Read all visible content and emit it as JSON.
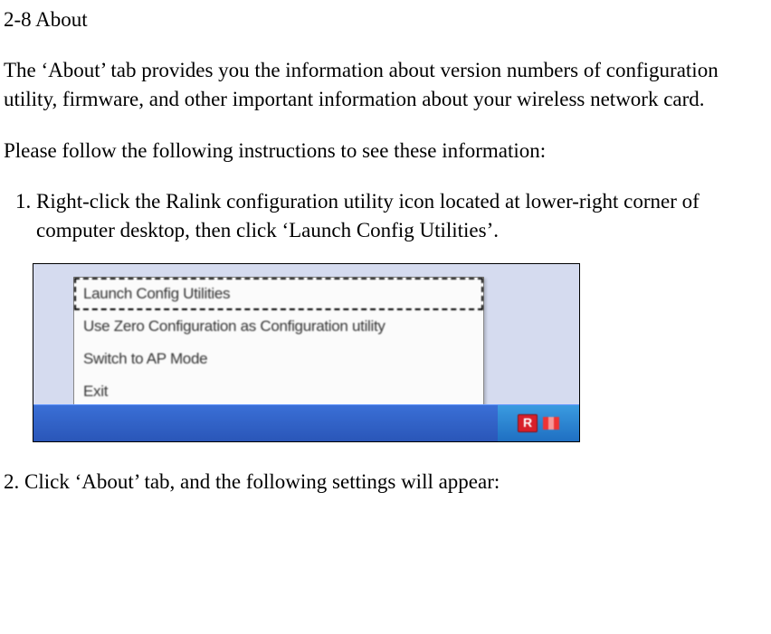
{
  "section": {
    "title": "2-8 About"
  },
  "para1": "The ‘About’ tab provides you the information about version numbers of configuration utility, firmware, and other important information about your wireless network card.",
  "para2": "Please follow the following instructions to see these information:",
  "step1_prefix": "1.",
  "step1_text": "Right-click the Ralink configuration utility icon located at lower-right corner of computer desktop, then click ‘Launch Config Utilities’.",
  "menu": {
    "items": [
      "Launch Config Utilities",
      "Use Zero Configuration as Configuration utility",
      "Switch to AP Mode",
      "Exit"
    ]
  },
  "step2": "2. Click ‘About’ tab, and the following settings will appear:"
}
